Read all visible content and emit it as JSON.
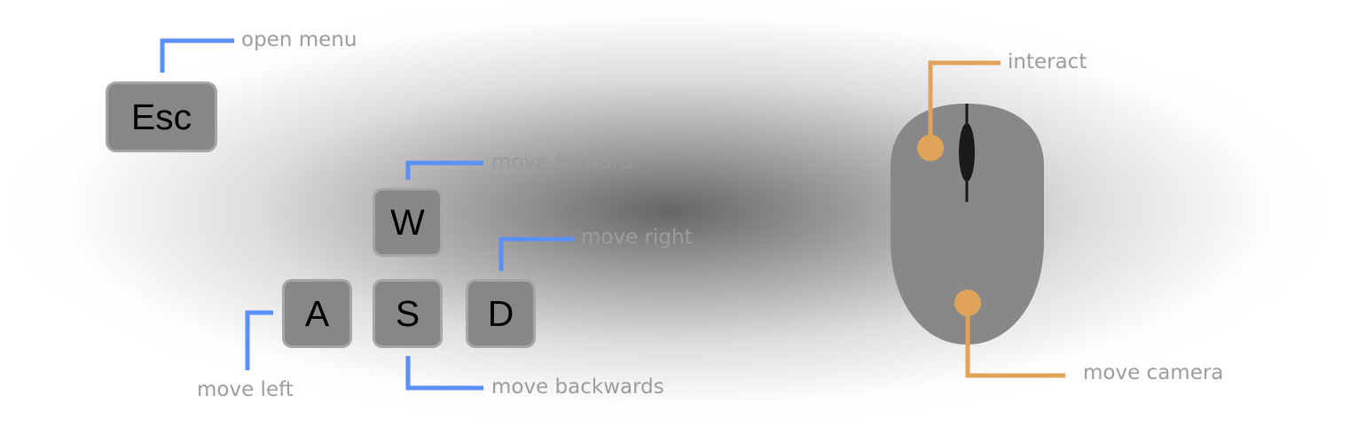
{
  "keyboard": {
    "keys": {
      "esc": "Esc",
      "w": "W",
      "a": "A",
      "s": "S",
      "d": "D"
    },
    "callout_color": "#5b8ff9"
  },
  "mouse": {
    "body_color": "#888888",
    "wheel_color": "#1a1a1a",
    "callout_color": "#e0a35a"
  },
  "labels": {
    "open_menu": "open menu",
    "move_forward": "move forward",
    "move_right": "move right",
    "move_left": "move left",
    "move_backwards": "move backwards",
    "interact": "interact",
    "move_camera": "move camera"
  }
}
